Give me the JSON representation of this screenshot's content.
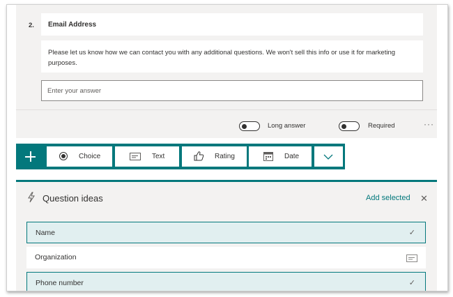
{
  "question": {
    "number": "2.",
    "title": "Email Address",
    "description": "Please let us know how we can contact you with any additional questions. We won't sell this info or use it for marketing purposes.",
    "answer_placeholder": "Enter your answer",
    "long_answer_label": "Long answer",
    "required_label": "Required",
    "more_label": "···"
  },
  "toolbar": {
    "add_label": "+",
    "choice_label": "Choice",
    "text_label": "Text",
    "rating_label": "Rating",
    "date_label": "Date"
  },
  "ideas": {
    "title": "Question ideas",
    "add_selected_label": "Add selected",
    "close_label": "✕",
    "items": [
      {
        "label": "Name",
        "selected": true
      },
      {
        "label": "Organization",
        "selected": false
      },
      {
        "label": "Phone number",
        "selected": true
      }
    ]
  },
  "colors": {
    "accent": "#03787c",
    "card_background": "#f3f2f1",
    "selected_row": "#e1eff0"
  },
  "icons": [
    "choice-radio-icon",
    "text-type-icon",
    "rating-thumb-icon",
    "calendar-icon",
    "chevron-down-icon",
    "lightning-icon",
    "check-icon",
    "close-icon"
  ]
}
